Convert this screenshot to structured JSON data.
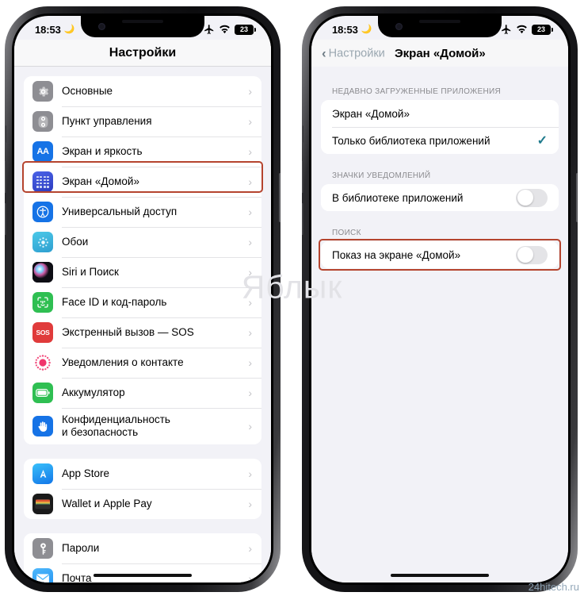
{
  "watermarks": {
    "center": "Яблык",
    "corner": "24hitech.ru"
  },
  "status_bar": {
    "time": "18:53",
    "moon_icon": "crescent-moon-icon",
    "airplane_icon": "airplane-mode-icon",
    "wifi_icon": "wifi-icon",
    "battery_level": "23"
  },
  "left_phone": {
    "nav": {
      "title": "Настройки"
    },
    "groups": [
      {
        "rows": [
          {
            "label": "Основные",
            "icon": "gear-icon",
            "icon_color": "#8e8e93",
            "glyph": "⚙"
          },
          {
            "label": "Пункт управления",
            "icon": "control-center-icon",
            "icon_color": "#8e8e93",
            "glyph": ""
          },
          {
            "label": "Экран и яркость",
            "icon": "display-brightness-icon",
            "icon_color": "#1673e6",
            "glyph": "AA"
          },
          {
            "label": "Экран «Домой»",
            "icon": "home-screen-icon",
            "icon_color": "#3b4fd8",
            "glyph": "",
            "highlighted": true
          },
          {
            "label": "Универсальный доступ",
            "icon": "accessibility-icon",
            "icon_color": "#1673e6",
            "glyph": "♿"
          },
          {
            "label": "Обои",
            "icon": "wallpaper-icon",
            "icon_color": "#36b5e0",
            "glyph": "✲"
          },
          {
            "label": "Siri и Поиск",
            "icon": "siri-icon",
            "icon_color": "#1a1a2e",
            "glyph": ""
          },
          {
            "label": "Face ID и код-пароль",
            "icon": "face-id-icon",
            "icon_color": "#2fbf52",
            "glyph": "☺"
          },
          {
            "label": "Экстренный вызов — SOS",
            "icon": "emergency-sos-icon",
            "icon_color": "#e03b3b",
            "glyph": "SOS"
          },
          {
            "label": "Уведомления о контакте",
            "icon": "contact-notifications-icon",
            "icon_color": "#ffffff",
            "glyph": "◉"
          },
          {
            "label": "Аккумулятор",
            "icon": "battery-icon",
            "icon_color": "#2fbf52",
            "glyph": "▭"
          },
          {
            "label": "Конфиденциальность\nи безопасность",
            "icon": "privacy-security-icon",
            "icon_color": "#1673e6",
            "glyph": "✋"
          }
        ]
      },
      {
        "rows": [
          {
            "label": "App Store",
            "icon": "app-store-icon",
            "icon_color": "#1f9cf0",
            "glyph": "A"
          },
          {
            "label": "Wallet и Apple Pay",
            "icon": "wallet-icon",
            "icon_color": "#1a1a1a",
            "glyph": "▤"
          }
        ]
      },
      {
        "rows": [
          {
            "label": "Пароли",
            "icon": "passwords-key-icon",
            "icon_color": "#8e8e93",
            "glyph": "⚿"
          },
          {
            "label": "Почта",
            "icon": "mail-icon",
            "icon_color": "#3ea9f5",
            "glyph": "✉"
          }
        ]
      }
    ],
    "chevron": "›"
  },
  "right_phone": {
    "nav": {
      "back_label": "Настройки",
      "back_chevron": "‹",
      "title": "Экран «Домой»"
    },
    "sections": [
      {
        "header": "НЕДАВНО ЗАГРУЖЕННЫЕ ПРИЛОЖЕНИЯ",
        "rows": [
          {
            "label": "Экран «Домой»",
            "selected": false
          },
          {
            "label": "Только библиотека приложений",
            "selected": true,
            "check_glyph": "✓"
          }
        ]
      },
      {
        "header": "ЗНАЧКИ УВЕДОМЛЕНИЙ",
        "rows": [
          {
            "label": "В библиотеке приложений",
            "toggle": "off"
          }
        ]
      },
      {
        "header": "ПОИСК",
        "rows": [
          {
            "label": "Показ на экране «Домой»",
            "toggle": "off",
            "highlighted": true
          }
        ]
      }
    ]
  },
  "colors": {
    "highlight_border": "#b5442e",
    "screen_bg": "#f2f2f7",
    "card_bg": "#ffffff",
    "accent_check": "#1f7a8c",
    "back_link": "#9aa7b0"
  }
}
